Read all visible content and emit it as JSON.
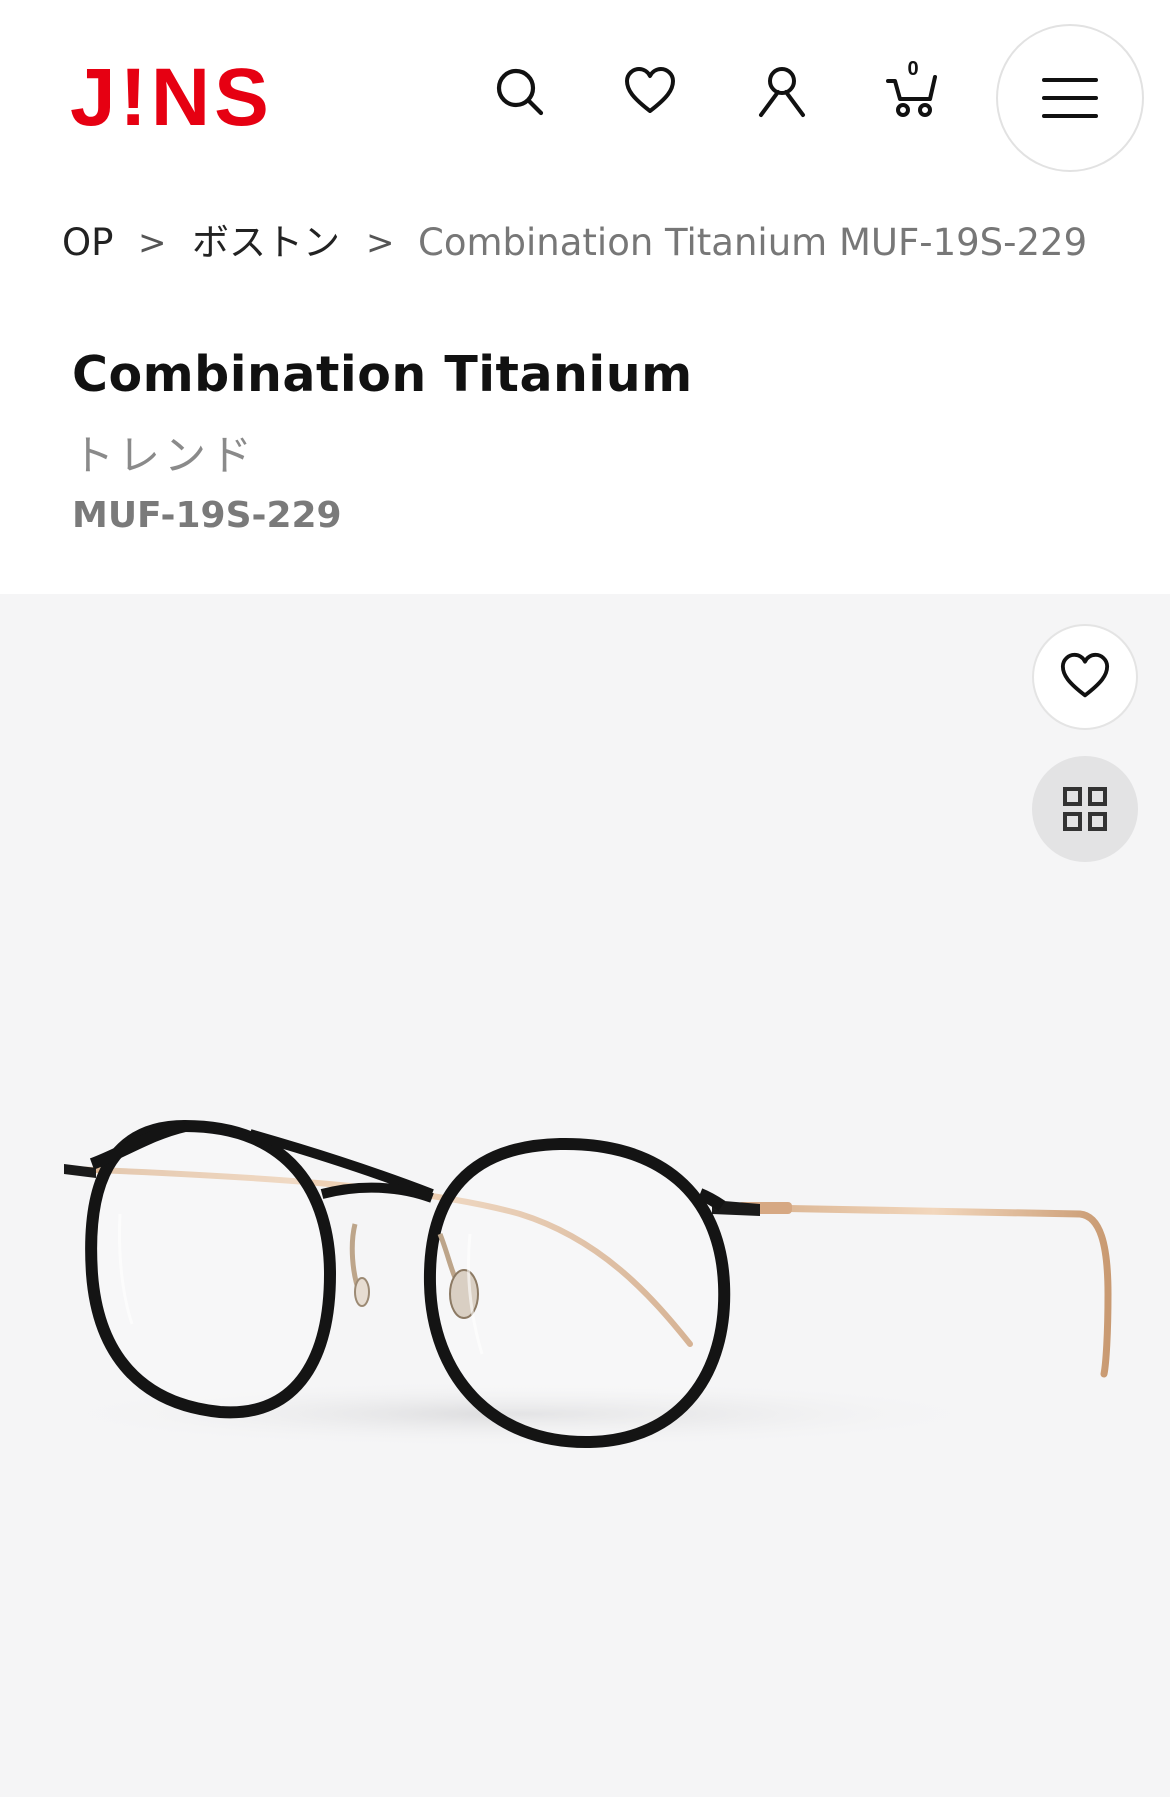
{
  "brand": {
    "logo_text": "J!NS",
    "logo_color": "#e60012"
  },
  "header": {
    "icons": [
      "search-icon",
      "heart-icon",
      "user-icon",
      "cart-icon",
      "menu-icon"
    ],
    "cart_count": "0"
  },
  "breadcrumb": {
    "items": [
      "OP",
      "ボストン",
      "Combination Titanium MUF-19S-229"
    ],
    "separator": ">"
  },
  "product": {
    "name": "Combination Titanium",
    "category": "トレンド",
    "code": "MUF-19S-229"
  },
  "gallery": {
    "background": "#f5f5f6",
    "buttons": [
      "heart-icon",
      "grid-view-icon"
    ]
  }
}
